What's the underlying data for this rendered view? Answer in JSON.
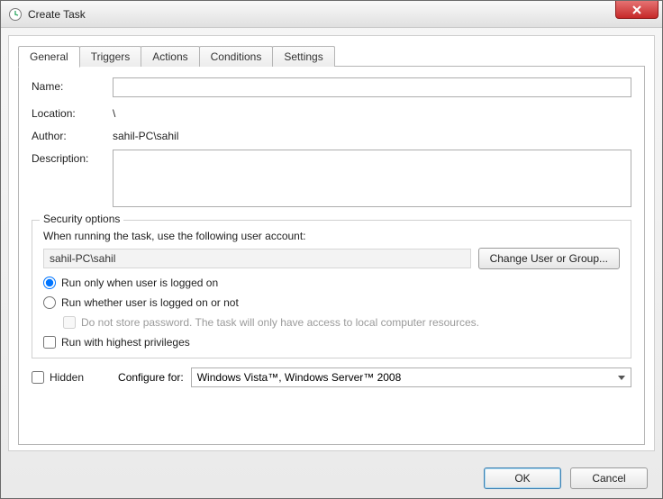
{
  "window": {
    "title": "Create Task"
  },
  "tabs": [
    {
      "label": "General",
      "active": true
    },
    {
      "label": "Triggers",
      "active": false
    },
    {
      "label": "Actions",
      "active": false
    },
    {
      "label": "Conditions",
      "active": false
    },
    {
      "label": "Settings",
      "active": false
    }
  ],
  "general": {
    "name_label": "Name:",
    "name_value": "",
    "location_label": "Location:",
    "location_value": "\\",
    "author_label": "Author:",
    "author_value": "sahil-PC\\sahil",
    "description_label": "Description:",
    "description_value": ""
  },
  "security": {
    "legend": "Security options",
    "when_running_label": "When running the task, use the following user account:",
    "user_account": "sahil-PC\\sahil",
    "change_user_button": "Change User or Group...",
    "run_logged_on_label": "Run only when user is logged on",
    "run_logged_on_checked": true,
    "run_whether_label": "Run whether user is logged on or not",
    "run_whether_checked": false,
    "do_not_store_label": "Do not store password.  The task will only have access to local computer resources.",
    "do_not_store_checked": false,
    "highest_priv_label": "Run with highest privileges",
    "highest_priv_checked": false
  },
  "bottom": {
    "hidden_label": "Hidden",
    "hidden_checked": false,
    "configure_for_label": "Configure for:",
    "configure_for_value": "Windows Vista™, Windows Server™ 2008"
  },
  "buttons": {
    "ok": "OK",
    "cancel": "Cancel"
  }
}
